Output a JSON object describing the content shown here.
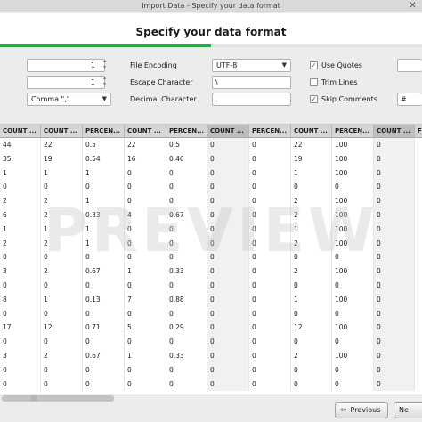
{
  "window": {
    "title": "Import Data - Specify your data format"
  },
  "header": {
    "title": "Specify your data format"
  },
  "progress": {
    "fraction": 0.5
  },
  "options": {
    "spinner1_value": "1",
    "spinner2_value": "1",
    "separator_value": "Comma \",\"",
    "file_encoding_label": "File Encoding",
    "file_encoding_value": "UTF-8",
    "escape_label": "Escape Character",
    "escape_value": "\\",
    "decimal_label": "Decimal Character",
    "decimal_value": ".",
    "use_quotes_label": "Use Quotes",
    "use_quotes_checked": true,
    "trim_lines_label": "Trim Lines",
    "trim_lines_checked": false,
    "skip_comments_label": "Skip Comments",
    "skip_comments_checked": true,
    "comment_char_value": "#"
  },
  "preview": {
    "watermark": "PREVIEW",
    "columns": [
      "COUNT ...",
      "COUNT ...",
      "PERCEN...",
      "COUNT ...",
      "PERCEN...",
      "COUNT ...",
      "PERCEN...",
      "COUNT ...",
      "PERCEN...",
      "COUNT ...",
      "F"
    ],
    "rows": [
      [
        "44",
        "22",
        "0.5",
        "22",
        "0.5",
        "0",
        "0",
        "22",
        "100",
        "0",
        "0"
      ],
      [
        "35",
        "19",
        "0.54",
        "16",
        "0.46",
        "0",
        "0",
        "19",
        "100",
        "0",
        "0"
      ],
      [
        "1",
        "1",
        "1",
        "0",
        "0",
        "0",
        "0",
        "1",
        "100",
        "0",
        "0"
      ],
      [
        "0",
        "0",
        "0",
        "0",
        "0",
        "0",
        "0",
        "0",
        "0",
        "0",
        "0"
      ],
      [
        "2",
        "2",
        "1",
        "0",
        "0",
        "0",
        "0",
        "2",
        "100",
        "0",
        "0"
      ],
      [
        "6",
        "2",
        "0.33",
        "4",
        "0.67",
        "0",
        "0",
        "2",
        "100",
        "0",
        "0"
      ],
      [
        "1",
        "1",
        "1",
        "0",
        "0",
        "0",
        "0",
        "1",
        "100",
        "0",
        "0"
      ],
      [
        "2",
        "2",
        "1",
        "0",
        "0",
        "0",
        "0",
        "2",
        "100",
        "0",
        "0"
      ],
      [
        "0",
        "0",
        "0",
        "0",
        "0",
        "0",
        "0",
        "0",
        "0",
        "0",
        "0"
      ],
      [
        "3",
        "2",
        "0.67",
        "1",
        "0.33",
        "0",
        "0",
        "2",
        "100",
        "0",
        "0"
      ],
      [
        "0",
        "0",
        "0",
        "0",
        "0",
        "0",
        "0",
        "0",
        "0",
        "0",
        "0"
      ],
      [
        "8",
        "1",
        "0.13",
        "7",
        "0.88",
        "0",
        "0",
        "1",
        "100",
        "0",
        "0"
      ],
      [
        "0",
        "0",
        "0",
        "0",
        "0",
        "0",
        "0",
        "0",
        "0",
        "0",
        "0"
      ],
      [
        "17",
        "12",
        "0.71",
        "5",
        "0.29",
        "0",
        "0",
        "12",
        "100",
        "0",
        "0"
      ],
      [
        "0",
        "0",
        "0",
        "0",
        "0",
        "0",
        "0",
        "0",
        "0",
        "0",
        "0"
      ],
      [
        "3",
        "2",
        "0.67",
        "1",
        "0.33",
        "0",
        "0",
        "2",
        "100",
        "0",
        "0"
      ],
      [
        "0",
        "0",
        "0",
        "0",
        "0",
        "0",
        "0",
        "0",
        "0",
        "0",
        "0"
      ],
      [
        "0",
        "0",
        "0",
        "0",
        "0",
        "0",
        "0",
        "0",
        "0",
        "0",
        "0"
      ]
    ]
  },
  "footer": {
    "previous_label": "Previous",
    "next_label": "Ne"
  },
  "colors": {
    "progress_green": "#29a84a",
    "header_bg": "#d6d6d6"
  }
}
